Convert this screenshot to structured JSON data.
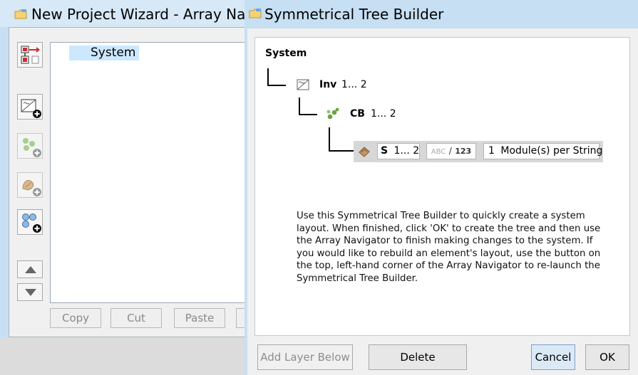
{
  "wizard": {
    "title": "New Project Wizard - Array Navigator",
    "tree": {
      "root_label": "System"
    },
    "buttons": {
      "copy": "Copy",
      "cut": "Cut",
      "paste": "Paste"
    }
  },
  "dialog": {
    "title": "Symmetrical Tree Builder",
    "tree": {
      "root_label": "System",
      "inverter": {
        "name": "Inv",
        "range": "1... 2",
        "icon": "inverter-icon"
      },
      "combiner": {
        "name": "CB",
        "range": "1... 2",
        "icon": "combiner-box-icon"
      },
      "string": {
        "name": "S",
        "range": "1... 2",
        "naming_toggle_abc": "ABC",
        "naming_toggle_sep": "/",
        "naming_toggle_num": "123",
        "modules_value": "1",
        "modules_label": "Module(s) per String",
        "icon": "string-icon"
      }
    },
    "instructions": "Use this Symmetrical Tree Builder to quickly create a system layout. When finished, click 'OK' to create the tree and then use the Array Navigator to finish making changes to the system. If you would like to rebuild an element's layout, use the button on the top, left-hand corner of the Array Navigator to re-launch the Symmetrical Tree Builder.",
    "buttons": {
      "add_layer_below": "Add Layer Below",
      "delete": "Delete",
      "cancel": "Cancel",
      "ok": "OK"
    }
  },
  "colors": {
    "window_frame": "#c6dff3",
    "selection": "#cce8ff",
    "row_highlight": "#d7d7d7"
  }
}
